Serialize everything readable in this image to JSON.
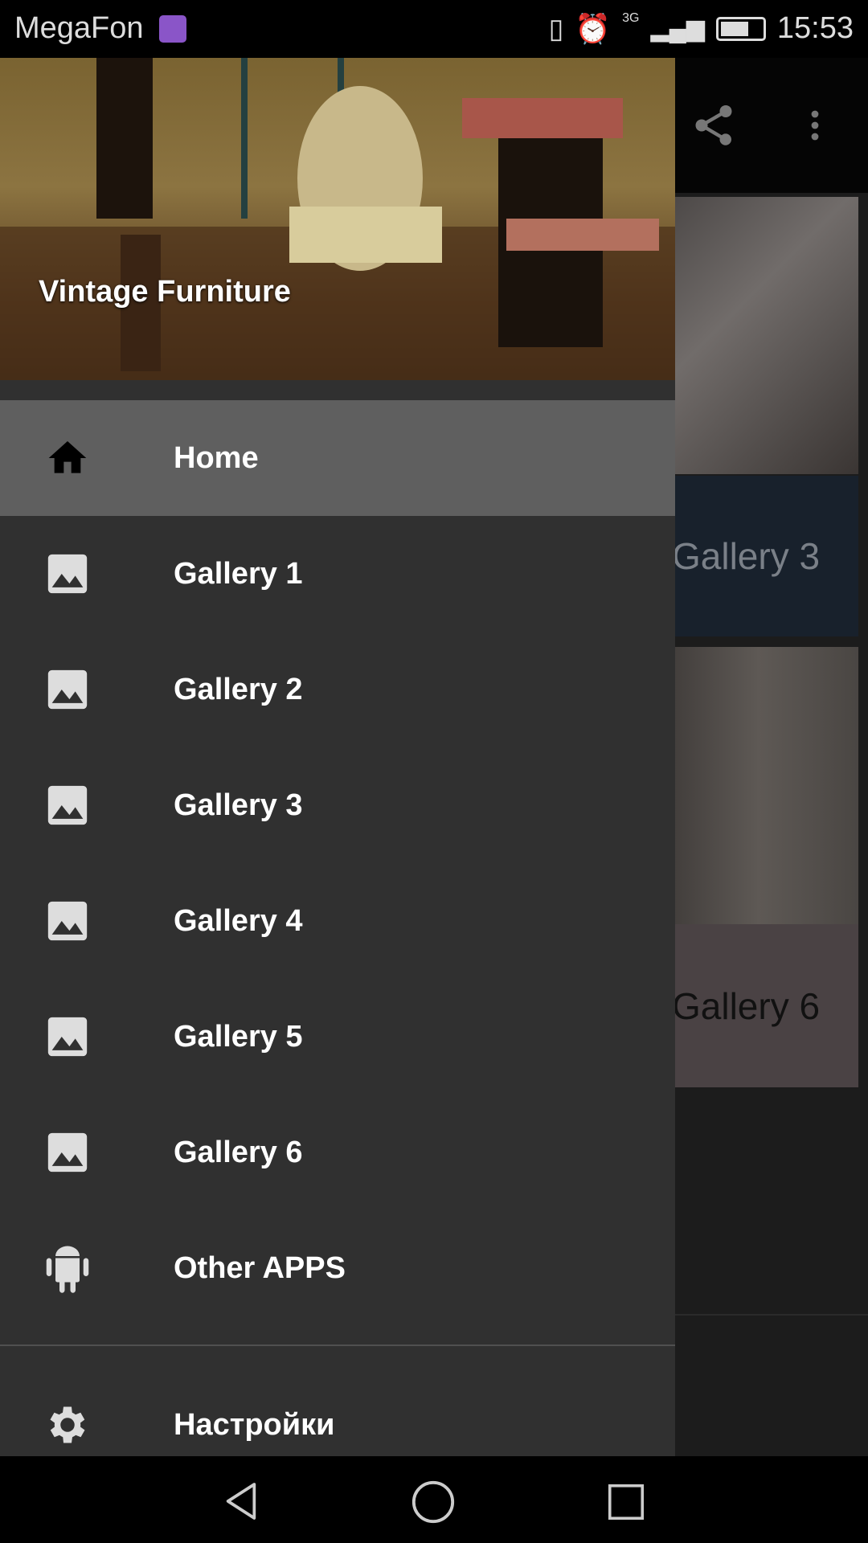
{
  "status_bar": {
    "carrier": "MegaFon",
    "time": "15:53",
    "network": "3G"
  },
  "background_app": {
    "toolbar_icons": [
      "share-icon",
      "more-vert-icon"
    ],
    "cards": [
      {
        "label": "Gallery 3",
        "color": "#18212c"
      },
      {
        "label": "Gallery 6",
        "color": "#4a4244"
      }
    ]
  },
  "drawer": {
    "header_title": "Vintage Furniture",
    "items": [
      {
        "label": "Home",
        "icon": "home-icon",
        "active": true
      },
      {
        "label": "Gallery 1",
        "icon": "image-icon"
      },
      {
        "label": "Gallery 2",
        "icon": "image-icon"
      },
      {
        "label": "Gallery 3",
        "icon": "image-icon"
      },
      {
        "label": "Gallery 4",
        "icon": "image-icon"
      },
      {
        "label": "Gallery 5",
        "icon": "image-icon"
      },
      {
        "label": "Gallery 6",
        "icon": "image-icon"
      },
      {
        "label": "Other APPS",
        "icon": "android-icon"
      }
    ],
    "settings_label": "Настройки"
  },
  "colors": {
    "drawer_bg": "#303030",
    "active_item": "#5f5f5f"
  }
}
